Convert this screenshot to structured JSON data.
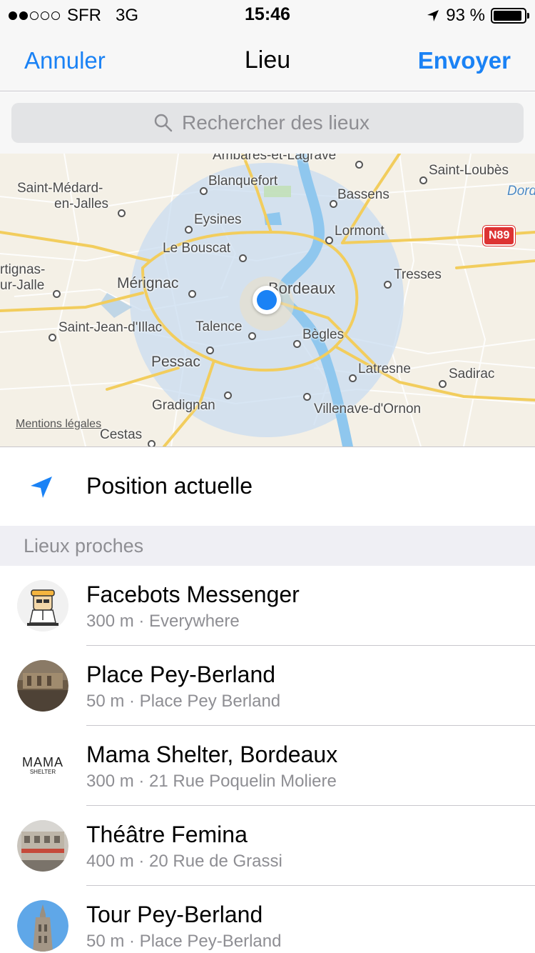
{
  "status_bar": {
    "carrier": "SFR",
    "network": "3G",
    "time": "15:46",
    "battery": "93 %",
    "battery_level": 0.93
  },
  "nav": {
    "cancel": "Annuler",
    "title": "Lieu",
    "send": "Envoyer"
  },
  "search": {
    "placeholder": "Rechercher des lieux"
  },
  "map": {
    "legal": "Mentions légales",
    "road_badge": "N89",
    "places": [
      "Ambarès-et-Lagrave",
      "Blanquefort",
      "Saint-Loubès",
      "Dordogne",
      "Saint-Médard-",
      "en-Jalles",
      "Bassens",
      "Eysines",
      "Lormont",
      "Le Bouscat",
      "rtignas-",
      "ur-Jalle",
      "Mérignac",
      "Bordeaux",
      "Tresses",
      "Saint-Jean-d'Illac",
      "Talence",
      "Bègles",
      "Pessac",
      "Latresne",
      "Sadirac",
      "Gradignan",
      "Villenave-d'Ornon",
      "Cestas"
    ]
  },
  "current_position": {
    "label": "Position actuelle"
  },
  "nearby": {
    "header": "Lieux proches",
    "items": [
      {
        "name": "Facebots Messenger",
        "detail": "300 m · Everywhere",
        "icon": "robot-avatar"
      },
      {
        "name": "Place Pey-Berland",
        "detail": "50 m · Place Pey Berland",
        "icon": "photo-avatar"
      },
      {
        "name": "Mama Shelter, Bordeaux",
        "detail": "300 m · 21 Rue Poquelin Moliere",
        "icon": "mama-shelter-logo",
        "logo_text": "MAMA",
        "logo_sub": "SHELTER"
      },
      {
        "name": "Théâtre Femina",
        "detail": "400 m · 20 Rue de Grassi",
        "icon": "photo-avatar"
      },
      {
        "name": "Tour Pey-Berland",
        "detail": "50 m · Place Pey-Berland",
        "icon": "photo-avatar"
      }
    ]
  },
  "colors": {
    "accent": "#1a82f5",
    "secondary_text": "#8e8e93",
    "map_bg": "#f4f0e6",
    "water": "#8fc7ee",
    "radius": "#c9dcf0"
  }
}
